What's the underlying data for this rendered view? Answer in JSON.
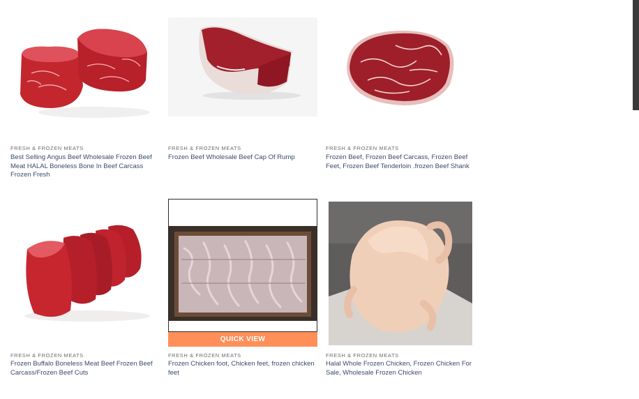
{
  "products": [
    {
      "category": "FRESH & FROZEN MEATS",
      "title": "Best Selling Angus Beef Wholesale Frozen Beef Meat HALAL Boneless Bone In Beef Carcass Frozen Fresh",
      "image": "beef-steaks-image"
    },
    {
      "category": "FRESH & FROZEN MEATS",
      "title": "Frozen Beef Wholesale Beef Cap Of Rump",
      "image": "beef-cap-of-rump-image"
    },
    {
      "category": "FRESH & FROZEN MEATS",
      "title": "Frozen Beef, Frozen Beef Carcass, Frozen Beef Feet, Frozen Beef Tenderloin .frozen Beef Shank",
      "image": "ribeye-steak-image"
    },
    {
      "category": "FRESH & FROZEN MEATS",
      "title": "Frozen Buffalo Boneless Meat Beef Frozen Beef Carcass/Frozen Beef Cuts",
      "image": "sliced-buffalo-meat-image"
    },
    {
      "category": "FRESH & FROZEN MEATS",
      "title": "Frozen Chicken foot, Chicken feet, frozen chicken feet",
      "image": "chicken-feet-box-image",
      "quick_view": "QUICK VIEW"
    },
    {
      "category": "FRESH & FROZEN MEATS",
      "title": "Halal Whole Frozen Chicken, Frozen Chicken For Sale, Wholesale Frozen Chicken",
      "image": "whole-chicken-image"
    }
  ],
  "colors": {
    "accent": "#ff8f59",
    "title_text": "#3a4a6b",
    "category_text": "#6b6b6b"
  }
}
